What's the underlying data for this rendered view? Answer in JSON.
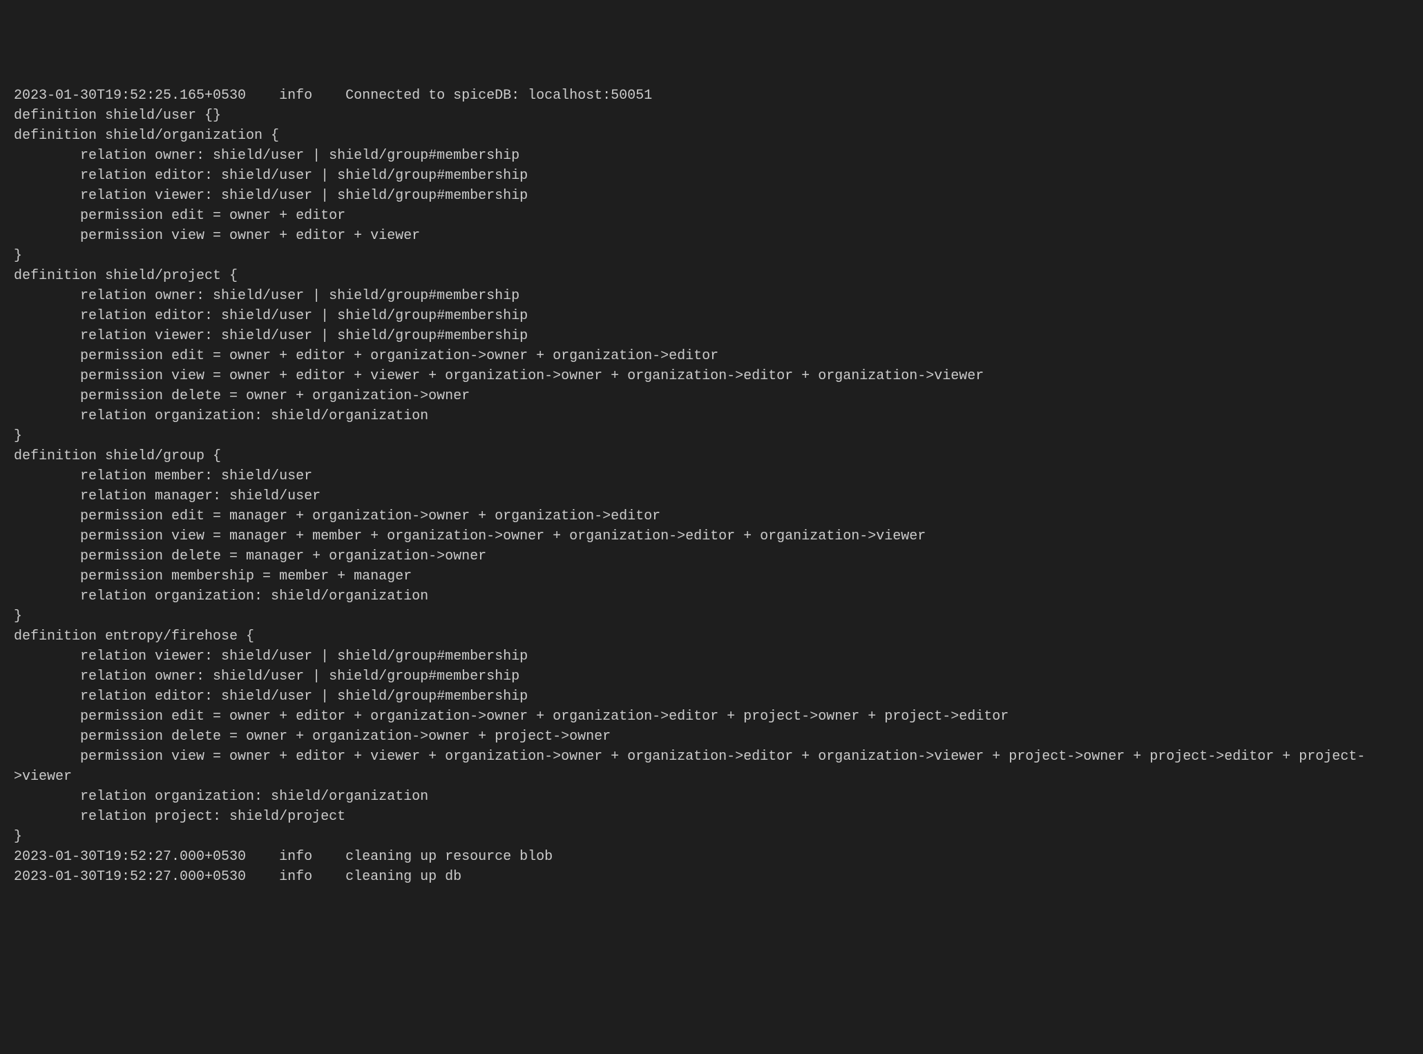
{
  "lines": [
    "2023-01-30T19:52:25.165+0530    info    Connected to spiceDB: localhost:50051",
    "definition shield/user {}",
    "definition shield/organization {",
    "        relation owner: shield/user | shield/group#membership",
    "        relation editor: shield/user | shield/group#membership",
    "        relation viewer: shield/user | shield/group#membership",
    "        permission edit = owner + editor",
    "        permission view = owner + editor + viewer",
    "}",
    "definition shield/project {",
    "        relation owner: shield/user | shield/group#membership",
    "        relation editor: shield/user | shield/group#membership",
    "        relation viewer: shield/user | shield/group#membership",
    "        permission edit = owner + editor + organization->owner + organization->editor",
    "        permission view = owner + editor + viewer + organization->owner + organization->editor + organization->viewer",
    "        permission delete = owner + organization->owner",
    "        relation organization: shield/organization",
    "}",
    "definition shield/group {",
    "        relation member: shield/user",
    "        relation manager: shield/user",
    "        permission edit = manager + organization->owner + organization->editor",
    "        permission view = manager + member + organization->owner + organization->editor + organization->viewer",
    "        permission delete = manager + organization->owner",
    "        permission membership = member + manager",
    "        relation organization: shield/organization",
    "}",
    "definition entropy/firehose {",
    "        relation viewer: shield/user | shield/group#membership",
    "        relation owner: shield/user | shield/group#membership",
    "        relation editor: shield/user | shield/group#membership",
    "        permission edit = owner + editor + organization->owner + organization->editor + project->owner + project->editor",
    "        permission delete = owner + organization->owner + project->owner",
    "        permission view = owner + editor + viewer + organization->owner + organization->editor + organization->viewer + project->owner + project->editor + project->viewer",
    "        relation organization: shield/organization",
    "        relation project: shield/project",
    "}",
    "2023-01-30T19:52:27.000+0530    info    cleaning up resource blob",
    "2023-01-30T19:52:27.000+0530    info    cleaning up db"
  ]
}
